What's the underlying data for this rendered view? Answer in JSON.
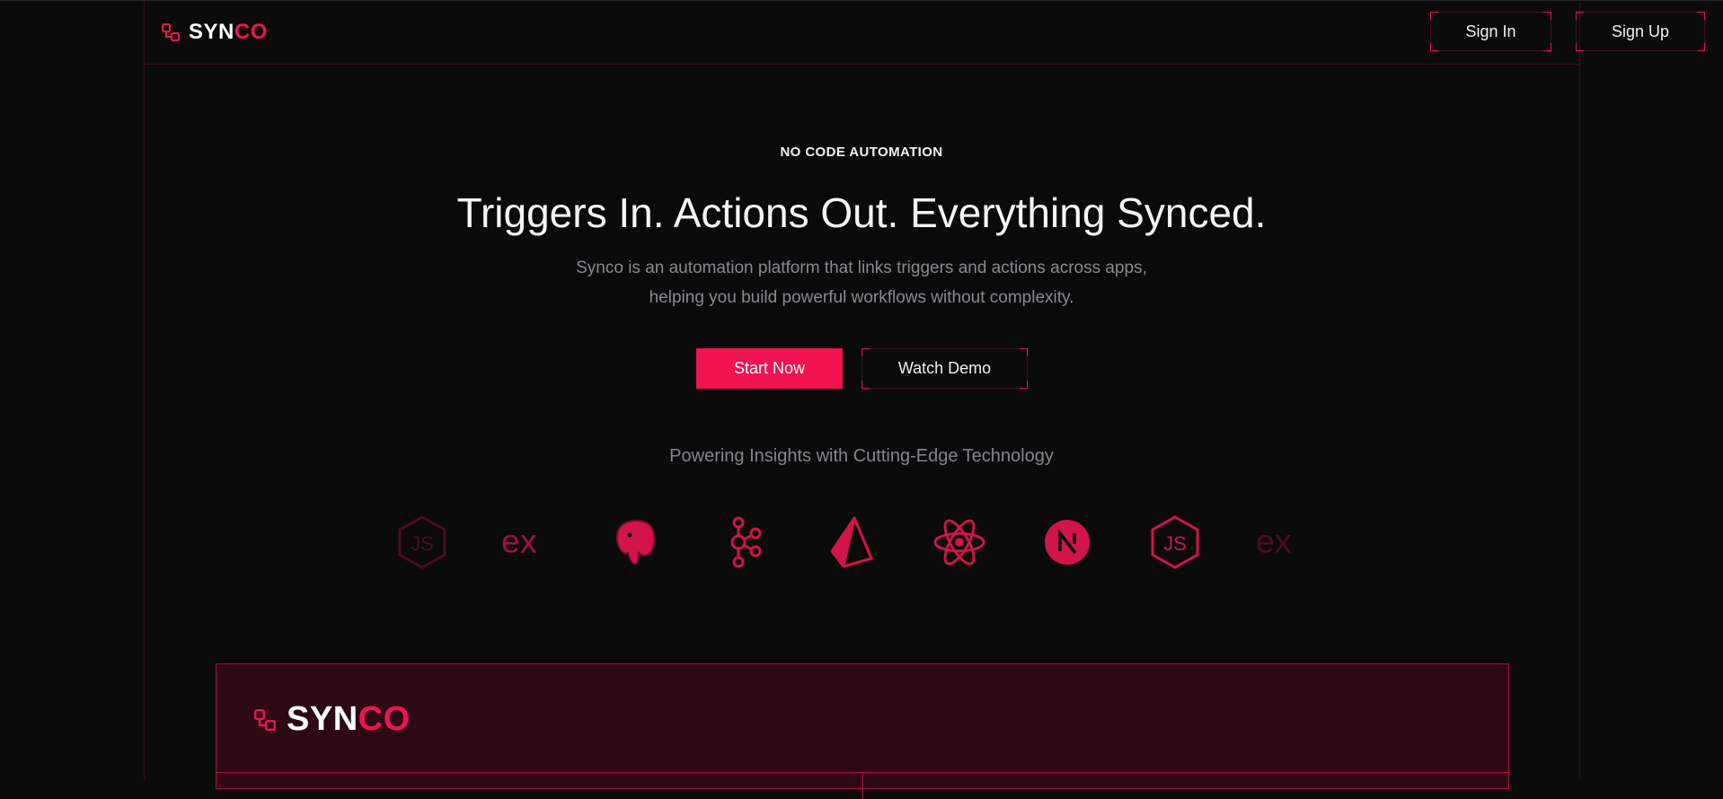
{
  "brand": {
    "syn": "SYN",
    "co": "CO",
    "accent": "#f0134f"
  },
  "nav": {
    "sign_in": "Sign In",
    "sign_up": "Sign Up"
  },
  "hero": {
    "eyebrow": "NO CODE AUTOMATION",
    "headline": "Triggers In. Actions Out. Everything Synced.",
    "subtitle_line1": "Synco is an automation platform that links triggers and actions across apps,",
    "subtitle_line2": "helping you build powerful workflows without complexity.",
    "start_label": "Start Now",
    "watch_label": "Watch Demo"
  },
  "tech": {
    "heading": "Powering Insights with Cutting-Edge Technology",
    "logos": [
      "nodejs-icon",
      "express-icon",
      "postgresql-icon",
      "kafka-icon",
      "prisma-icon",
      "react-icon",
      "nextjs-icon",
      "nodejs-icon",
      "express-icon"
    ]
  },
  "card": {
    "syn": "SYN",
    "co": "CO"
  }
}
